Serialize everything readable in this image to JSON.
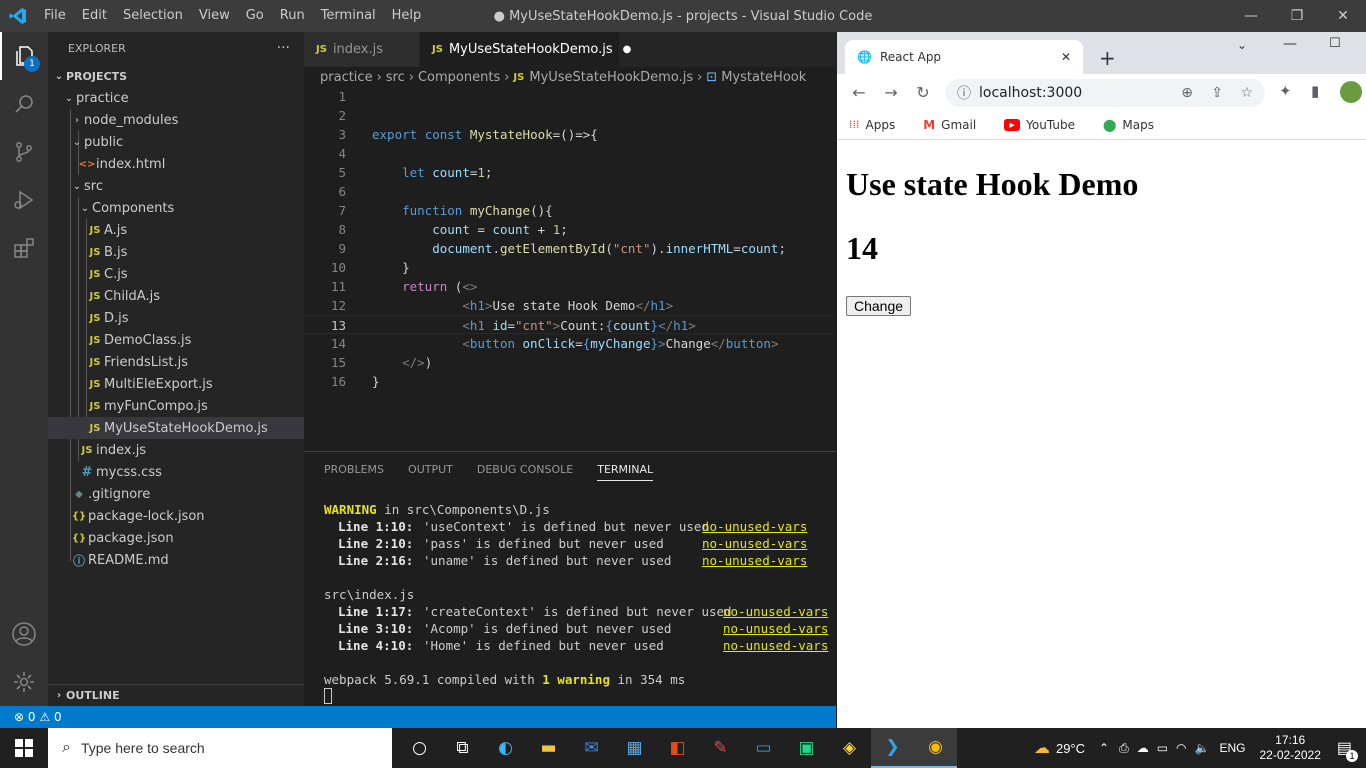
{
  "titlebar": {
    "menu": [
      "File",
      "Edit",
      "Selection",
      "View",
      "Go",
      "Run",
      "Terminal",
      "Help"
    ],
    "title": "● MyUseStateHookDemo.js - projects - Visual Studio Code"
  },
  "activity": {
    "badge": "1"
  },
  "sidebar": {
    "explorer_label": "EXPLORER",
    "more": "···",
    "root": "PROJECTS",
    "items": [
      {
        "label": "practice"
      },
      {
        "label": "node_modules"
      },
      {
        "label": "public"
      },
      {
        "label": "index.html"
      },
      {
        "label": "src"
      },
      {
        "label": "Components"
      },
      {
        "label": "A.js"
      },
      {
        "label": "B.js"
      },
      {
        "label": "C.js"
      },
      {
        "label": "ChildA.js"
      },
      {
        "label": "D.js"
      },
      {
        "label": "DemoClass.js"
      },
      {
        "label": "FriendsList.js"
      },
      {
        "label": "MultiEleExport.js"
      },
      {
        "label": "myFunCompo.js"
      },
      {
        "label": "MyUseStateHookDemo.js"
      },
      {
        "label": "index.js"
      },
      {
        "label": "mycss.css"
      },
      {
        "label": ".gitignore"
      },
      {
        "label": "package-lock.json"
      },
      {
        "label": "package.json"
      },
      {
        "label": "README.md"
      }
    ],
    "outline": "OUTLINE"
  },
  "tabs": [
    {
      "label": "index.js"
    },
    {
      "label": "MyUseStateHookDemo.js"
    }
  ],
  "breadcrumb": [
    "practice",
    "src",
    "Components",
    "MyUseStateHookDemo.js",
    "MystateHook"
  ],
  "code": {
    "line_numbers": [
      "1",
      "2",
      "3",
      "4",
      "5",
      "6",
      "7",
      "8",
      "9",
      "10",
      "11",
      "12",
      "13",
      "14",
      "15",
      "16"
    ]
  },
  "panel": {
    "tabs": [
      "PROBLEMS",
      "OUTPUT",
      "DEBUG CONSOLE",
      "TERMINAL"
    ],
    "terminal": {
      "warning": "WARNING",
      "warning_file": " in src\\Components\\D.js",
      "d_lines": [
        {
          "loc": "Line 1:10:",
          "msg": "'useContext' is defined but never used",
          "rule": "no-unused-vars"
        },
        {
          "loc": "Line 2:10:",
          "msg": "'pass' is defined but never used",
          "rule": "no-unused-vars"
        },
        {
          "loc": "Line 2:16:",
          "msg": "'uname' is defined but never used",
          "rule": "no-unused-vars"
        }
      ],
      "index_file": "src\\index.js",
      "i_lines": [
        {
          "loc": "Line 1:17:",
          "msg": "'createContext' is defined but never used",
          "rule": "no-unused-vars"
        },
        {
          "loc": "Line 3:10:",
          "msg": "'Acomp' is defined but never used",
          "rule": "no-unused-vars"
        },
        {
          "loc": "Line 4:10:",
          "msg": "'Home' is defined but never used",
          "rule": "no-unused-vars"
        }
      ],
      "compiled_pre": "webpack 5.69.1 compiled with ",
      "compiled_warn": "1 warning",
      "compiled_post": " in 354 ms"
    }
  },
  "statusbar": {
    "errors": "0",
    "warnings": "0"
  },
  "browser": {
    "tab_title": "React App",
    "url": "localhost:3000",
    "bookmarks": [
      "Apps",
      "Gmail",
      "YouTube",
      "Maps"
    ],
    "page": {
      "heading": "Use state Hook Demo",
      "count": "14",
      "button": "Change"
    }
  },
  "taskbar": {
    "search_placeholder": "Type here to search",
    "weather": "29°C",
    "lang": "ENG",
    "time": "17:16",
    "date": "22-02-2022",
    "notif": "1"
  },
  "colors": {
    "accent": "#007acc",
    "terminal_warning": "#e5e510"
  }
}
